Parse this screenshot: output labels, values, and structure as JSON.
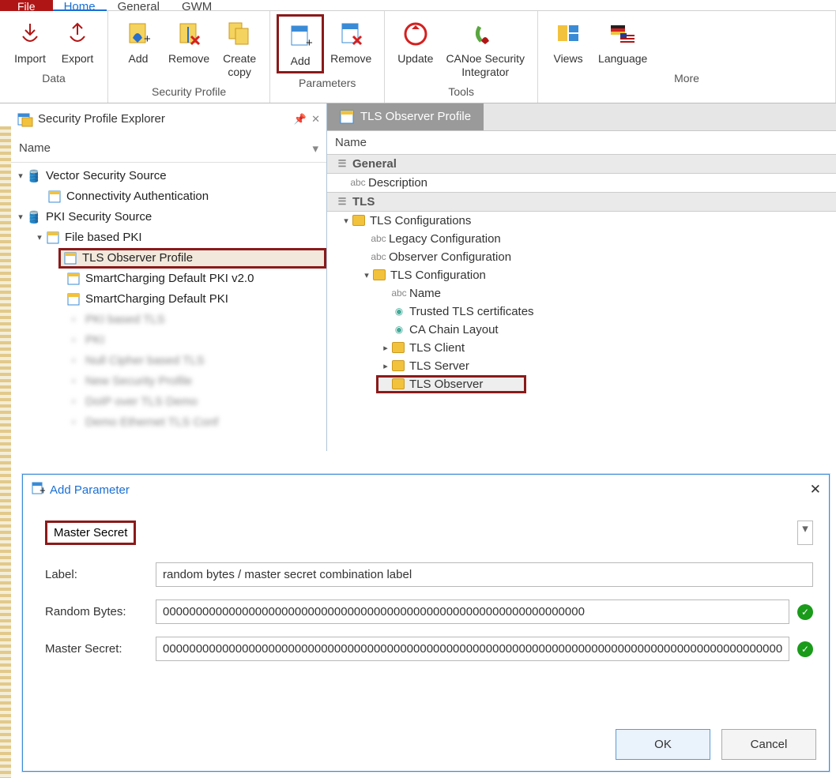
{
  "tabs": {
    "file": "File",
    "home": "Home",
    "general": "General",
    "gwm": "GWM"
  },
  "ribbon": {
    "data": {
      "label": "Data",
      "import": "Import",
      "export": "Export"
    },
    "secprof": {
      "label": "Security Profile",
      "add": "Add",
      "remove": "Remove",
      "createcopy": "Create\ncopy"
    },
    "params": {
      "label": "Parameters",
      "add": "Add",
      "remove": "Remove"
    },
    "tools": {
      "label": "Tools",
      "update": "Update",
      "integrator": "CANoe Security\nIntegrator"
    },
    "more": {
      "label": "More",
      "views": "Views",
      "language": "Language"
    }
  },
  "explorer": {
    "title": "Security Profile Explorer",
    "name": "Name",
    "nodes": {
      "vss": "Vector Security Source",
      "conn": "Connectivity Authentication",
      "pki": "PKI Security Source",
      "file": "File based PKI",
      "tlsobs": "TLS Observer Profile",
      "sc2": "SmartCharging Default PKI v2.0",
      "sc1": "SmartCharging Default PKI",
      "b1": "PKI based TLS",
      "b2": "PKI",
      "b3": "Null Cipher based TLS",
      "b4": "New Security Profile",
      "b5": "DoIP over TLS Demo",
      "b6": "Demo Ethernet TLS Conf"
    }
  },
  "detail": {
    "tab": "TLS Observer Profile",
    "name": "Name",
    "general": "General",
    "desc": "Description",
    "tls": "TLS",
    "tlsconfs": "TLS Configurations",
    "legacy": "Legacy Configuration",
    "obsconf": "Observer Configuration",
    "tlsconf": "TLS Configuration",
    "pname": "Name",
    "trusted": "Trusted TLS certificates",
    "chain": "CA Chain Layout",
    "client": "TLS Client",
    "server": "TLS Server",
    "observer": "TLS Observer"
  },
  "dialog": {
    "title": "Add Parameter",
    "type": "Master Secret",
    "label_lbl": "Label:",
    "label_val": "random bytes / master secret combination label",
    "rb_lbl": "Random Bytes:",
    "rb_val": "0000000000000000000000000000000000000000000000000000000000000000",
    "ms_lbl": "Master Secret:",
    "ms_val": "000000000000000000000000000000000000000000000000000000000000000000000000000000000000000000000000",
    "ok": "OK",
    "cancel": "Cancel"
  }
}
